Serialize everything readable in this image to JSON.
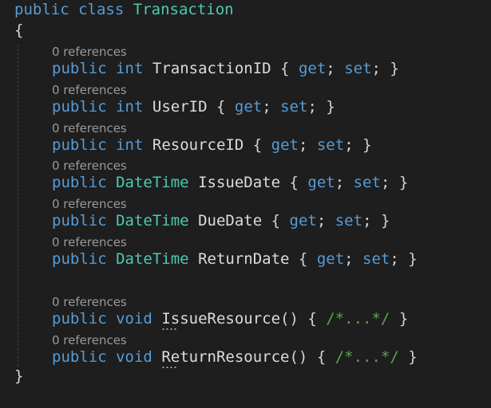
{
  "editor": {
    "class_decl": {
      "keyword_public": "public",
      "keyword_class": "class",
      "name": "Transaction"
    },
    "open_brace": "{",
    "close_brace": "}",
    "codelens": "0 references",
    "get": "get",
    "set": "set",
    "properties": [
      {
        "modifier": "public",
        "type": "int",
        "name": "TransactionID"
      },
      {
        "modifier": "public",
        "type": "int",
        "name": "UserID"
      },
      {
        "modifier": "public",
        "type": "int",
        "name": "ResourceID"
      },
      {
        "modifier": "public",
        "type": "DateTime",
        "name": "IssueDate"
      },
      {
        "modifier": "public",
        "type": "DateTime",
        "name": "DueDate"
      },
      {
        "modifier": "public",
        "type": "DateTime",
        "name": "ReturnDate"
      }
    ],
    "methods": [
      {
        "modifier": "public",
        "return_type": "void",
        "name": "IssueResource",
        "params": "()",
        "body_comment": "/*...*/"
      },
      {
        "modifier": "public",
        "return_type": "void",
        "name": "ReturnResource",
        "params": "()",
        "body_comment": "/*...*/"
      }
    ],
    "colors": {
      "background": "#1e1e1e",
      "keyword": "#569cd6",
      "type": "#4ec9b0",
      "identifier": "#dcdcdc",
      "comment": "#57a64a",
      "codelens": "#999999"
    }
  }
}
